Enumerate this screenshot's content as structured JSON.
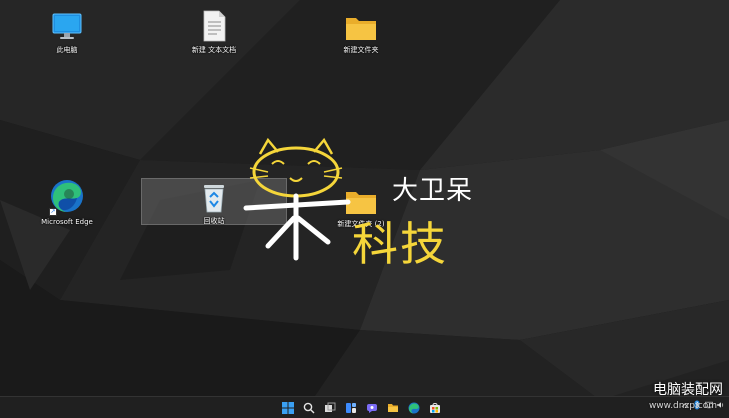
{
  "desktop": {
    "icons": [
      {
        "label": "此电脑",
        "icon": "monitor-icon"
      },
      {
        "label": "新建 文本文档",
        "icon": "text-document-icon"
      },
      {
        "label": "新建文件夹",
        "icon": "folder-icon"
      },
      {
        "label": "Microsoft Edge",
        "icon": "edge-icon"
      },
      {
        "label": "回收站",
        "icon": "recycle-bin-icon",
        "selected": true
      },
      {
        "label": "新建文件夹 (2)",
        "icon": "folder-icon"
      }
    ]
  },
  "watermark": {
    "line1": "大卫呆",
    "line2": "科技",
    "colors": {
      "white": "#ffffff",
      "yellow": "#f5d63a"
    }
  },
  "taskbar": {
    "buttons": [
      {
        "icon": "windows-start-icon"
      },
      {
        "icon": "search-icon"
      },
      {
        "icon": "task-view-icon"
      },
      {
        "icon": "widgets-icon"
      },
      {
        "icon": "chat-icon"
      },
      {
        "icon": "file-explorer-icon"
      },
      {
        "icon": "edge-icon"
      },
      {
        "icon": "store-icon"
      }
    ],
    "tray": {
      "icons": [
        "chevron-up-icon",
        "bluetooth-icon",
        "network-icon",
        "volume-icon"
      ]
    }
  },
  "site": {
    "name": "电脑装配网",
    "url": "www.dnzp.com"
  },
  "colors": {
    "taskbar": "#202020",
    "folder": "#f6c443",
    "selection": "#7a7a7a"
  }
}
